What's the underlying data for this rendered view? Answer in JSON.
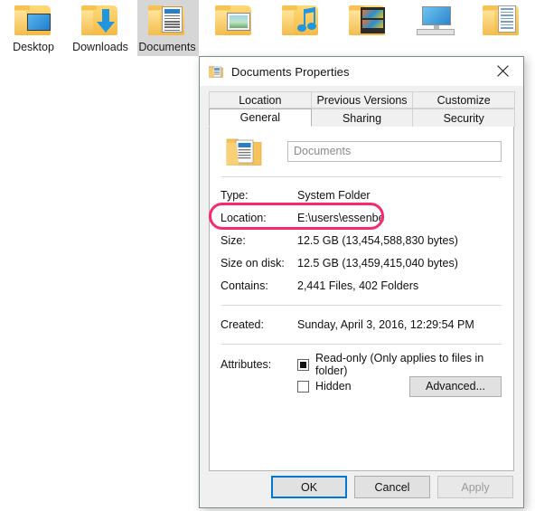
{
  "desktop": {
    "icons": [
      {
        "label": "Desktop",
        "icon": "folder-desktop-icon",
        "selected": false
      },
      {
        "label": "Downloads",
        "icon": "folder-downloads-icon",
        "selected": false
      },
      {
        "label": "Documents",
        "icon": "folder-documents-icon",
        "selected": true
      },
      {
        "label": "",
        "icon": "folder-pictures-icon",
        "selected": false
      },
      {
        "label": "",
        "icon": "folder-music-icon",
        "selected": false
      },
      {
        "label": "",
        "icon": "folder-videos-icon",
        "selected": false
      },
      {
        "label": "",
        "icon": "this-pc-icon",
        "selected": false
      },
      {
        "label": "",
        "icon": "folder-documents-2-icon",
        "selected": false
      }
    ]
  },
  "dialog": {
    "title": "Documents Properties",
    "title_icon": "folder-documents-icon",
    "close_icon": "close-icon",
    "tabs_top": [
      {
        "label": "Location",
        "active": false
      },
      {
        "label": "Previous Versions",
        "active": false
      },
      {
        "label": "Customize",
        "active": false
      }
    ],
    "tabs_bottom": [
      {
        "label": "General",
        "active": true
      },
      {
        "label": "Sharing",
        "active": false
      },
      {
        "label": "Security",
        "active": false
      }
    ],
    "name_field": {
      "value": "Documents",
      "icon": "folder-documents-icon"
    },
    "properties": [
      {
        "key": "Type:",
        "value": "System Folder"
      },
      {
        "key": "Location:",
        "value": "E:\\users\\essenbe"
      },
      {
        "key": "Size:",
        "value": "12.5 GB (13,454,588,830 bytes)"
      },
      {
        "key": "Size on disk:",
        "value": "12.5 GB (13,459,415,040 bytes)"
      },
      {
        "key": "Contains:",
        "value": "2,441 Files, 402 Folders"
      }
    ],
    "created": {
      "key": "Created:",
      "value": "Sunday, April 3, 2016, 12:29:54 PM"
    },
    "attributes": {
      "key": "Attributes:",
      "readonly": {
        "label": "Read-only (Only applies to files in folder)",
        "state": "indeterminate"
      },
      "hidden": {
        "label": "Hidden",
        "state": "unchecked"
      },
      "advanced_label": "Advanced..."
    },
    "buttons": {
      "ok": "OK",
      "cancel": "Cancel",
      "apply": "Apply"
    }
  },
  "annotation": {
    "target": "Location:",
    "color": "#f9296b",
    "shape": "rounded-rectangle"
  }
}
